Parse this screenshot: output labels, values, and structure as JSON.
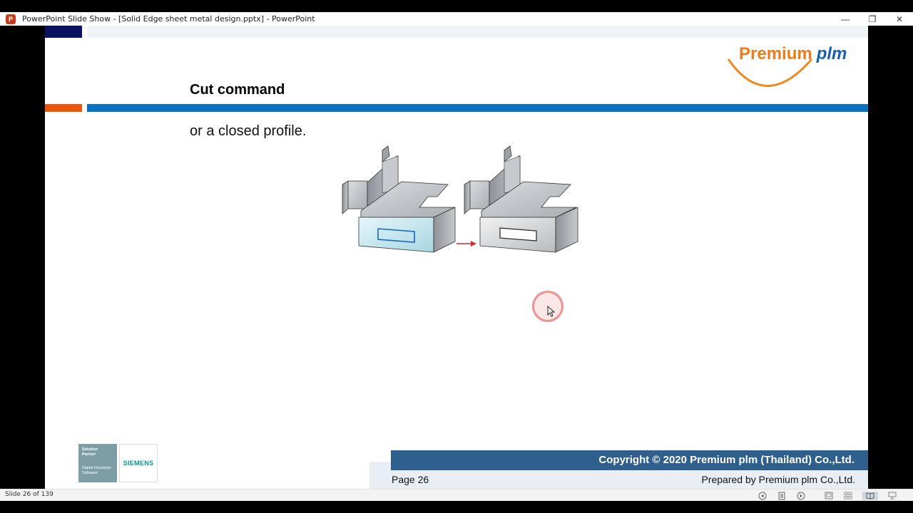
{
  "window": {
    "title": "PowerPoint Slide Show - [Solid Edge sheet metal design.pptx] - PowerPoint",
    "app_icon_letter": "P",
    "controls": {
      "minimize": "—",
      "restore": "❐",
      "close": "✕"
    }
  },
  "slide": {
    "logo": {
      "word1": "Premium",
      "word2": "plm"
    },
    "title": "Cut command",
    "body": "or a closed profile.",
    "partner": {
      "line1": "Solution",
      "line2": "Partner",
      "line3": "Digital Industries",
      "line4": "Software"
    },
    "siemens": "SIEMENS",
    "footer": {
      "copyright": "Copyright © 2020 Premium plm (Thailand) Co.,Ltd.",
      "page": "Page 26",
      "prepared": "Prepared by Premium plm Co.,Ltd."
    }
  },
  "statusbar": {
    "slide_count": "Slide 26 of 139",
    "icons": [
      "previous-icon",
      "menu-icon",
      "next-icon",
      "normal-view-icon",
      "slide-sorter-icon",
      "reading-view-icon",
      "slideshow-icon"
    ]
  },
  "colors": {
    "navy": "#0a1262",
    "orange": "#e8580c",
    "blue": "#0b72c0",
    "footer_blue": "#2f5f8c",
    "logo_orange": "#ef7a1a",
    "logo_blue": "#1d5ea8"
  }
}
